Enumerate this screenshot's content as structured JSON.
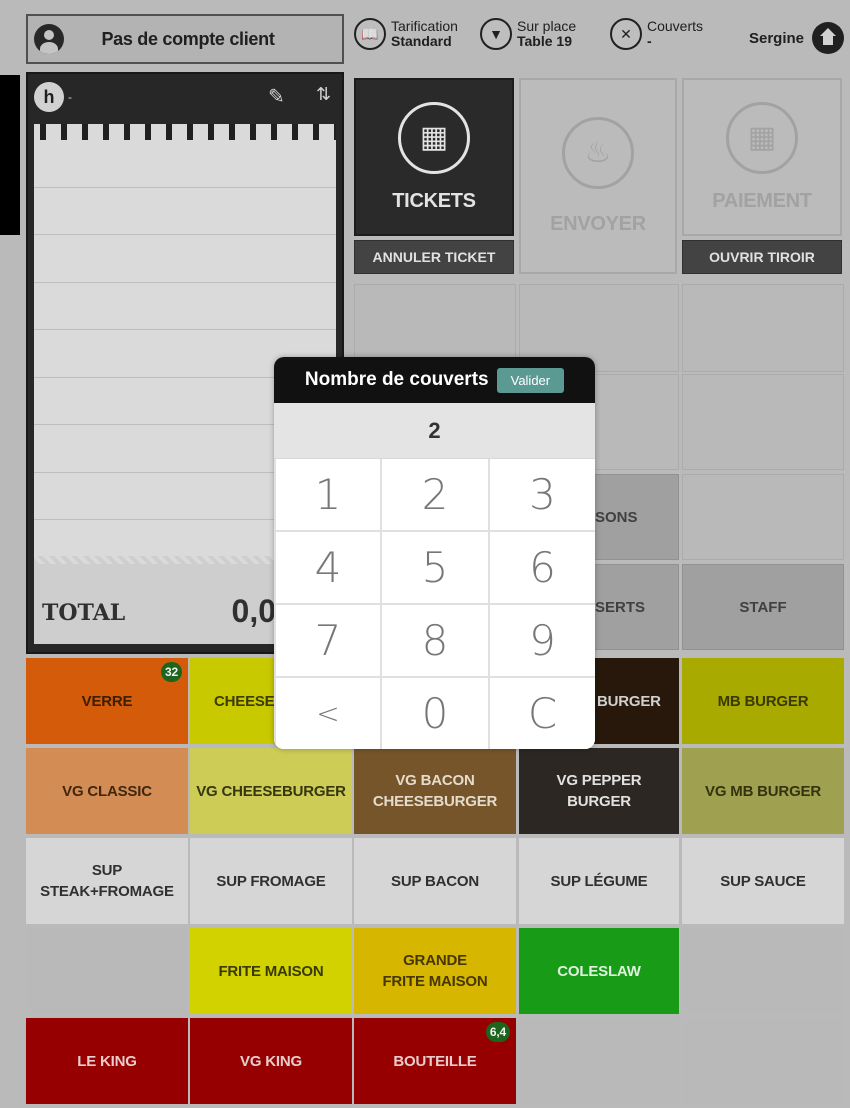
{
  "header": {
    "client": "Pas de compte client",
    "pricing": {
      "label": "Tarification",
      "value": "Standard"
    },
    "location": {
      "label": "Sur place",
      "value": "Table 19"
    },
    "covers": {
      "label": "Couverts",
      "value": "-"
    },
    "user": "Sergine"
  },
  "ticket": {
    "seat": "-",
    "total_label": "TOTAL",
    "total_value": "0,0"
  },
  "actions": {
    "tickets": "TICKETS",
    "envoyer": "ENVOYER",
    "paiement": "PAIEMENT",
    "annuler": "ANNULER TICKET",
    "tiroir": "OUVRIR TIROIR"
  },
  "categories": {
    "boissons": "SONS",
    "desserts": "SERTS",
    "staff": "STAFF"
  },
  "modal": {
    "title": "Nombre de couverts",
    "validate": "Valider",
    "value": "2",
    "keys": [
      "1",
      "2",
      "3",
      "4",
      "5",
      "6",
      "7",
      "8",
      "9",
      "<",
      "0",
      "C"
    ]
  },
  "products": {
    "row1": [
      {
        "label": "VERRE",
        "color": "#e0600a",
        "badge": "32"
      },
      {
        "label": "CHEESE",
        "color": "#d4d400"
      },
      {
        "label": "",
        "color": "#c3c3c3"
      },
      {
        "label": "BURGER",
        "color": "#2a1a0c"
      },
      {
        "label": "MB BURGER",
        "color": "#b3b400"
      }
    ],
    "row2": [
      {
        "label": "VG CLASSIC",
        "color": "#e0945a"
      },
      {
        "label": "VG CHEESEBURGER",
        "color": "#d7d75c"
      },
      {
        "label": "VG BACON CHEESEBURGER",
        "color": "#7e5a2e"
      },
      {
        "label": "VG PEPPER BURGER",
        "color": "#2f2a24"
      },
      {
        "label": "VG MB BURGER",
        "color": "#a8aa55"
      }
    ],
    "row3": [
      {
        "label": "SUP STEAK+FROMAGE",
        "color": "#e2e2e2"
      },
      {
        "label": "SUP FROMAGE",
        "color": "#e2e2e2"
      },
      {
        "label": "SUP BACON",
        "color": "#e2e2e2"
      },
      {
        "label": "SUP LÉGUME",
        "color": "#e2e2e2"
      },
      {
        "label": "SUP SAUCE",
        "color": "#e2e2e2"
      }
    ],
    "row4": [
      {
        "label": "FRITE MAISON",
        "color": "#dede00"
      },
      {
        "label": "GRANDE FRITE MAISON",
        "color": "#e3c000"
      },
      {
        "label": "COLESLAW",
        "color": "#1aa51a"
      }
    ],
    "row5": [
      {
        "label": "LE KING",
        "color": "#a00000"
      },
      {
        "label": "VG KING",
        "color": "#a00000"
      },
      {
        "label": "BOUTEILLE",
        "color": "#a00000",
        "badge": "6,4"
      }
    ]
  }
}
